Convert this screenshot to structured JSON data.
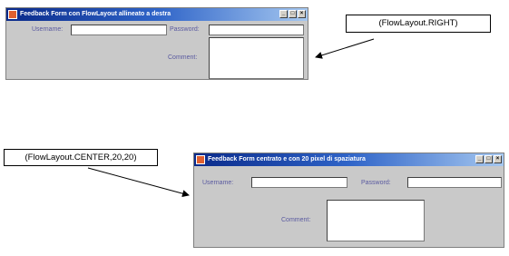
{
  "window_right": {
    "title": "Feedback Form con FlowLayout allineato a destra",
    "username_label": "Username:",
    "password_label": "Password:",
    "comment_label": "Comment:",
    "controls": [
      "_",
      "□",
      "×"
    ]
  },
  "window_center": {
    "title": "Feedback Form centrato e con 20 pixel di spaziatura",
    "username_label": "Username:",
    "password_label": "Password:",
    "comment_label": "Comment:",
    "controls": [
      "_",
      "□",
      "×"
    ]
  },
  "callouts": {
    "right": "(FlowLayout.RIGHT)",
    "center": "(FlowLayout.CENTER,20,20)"
  }
}
